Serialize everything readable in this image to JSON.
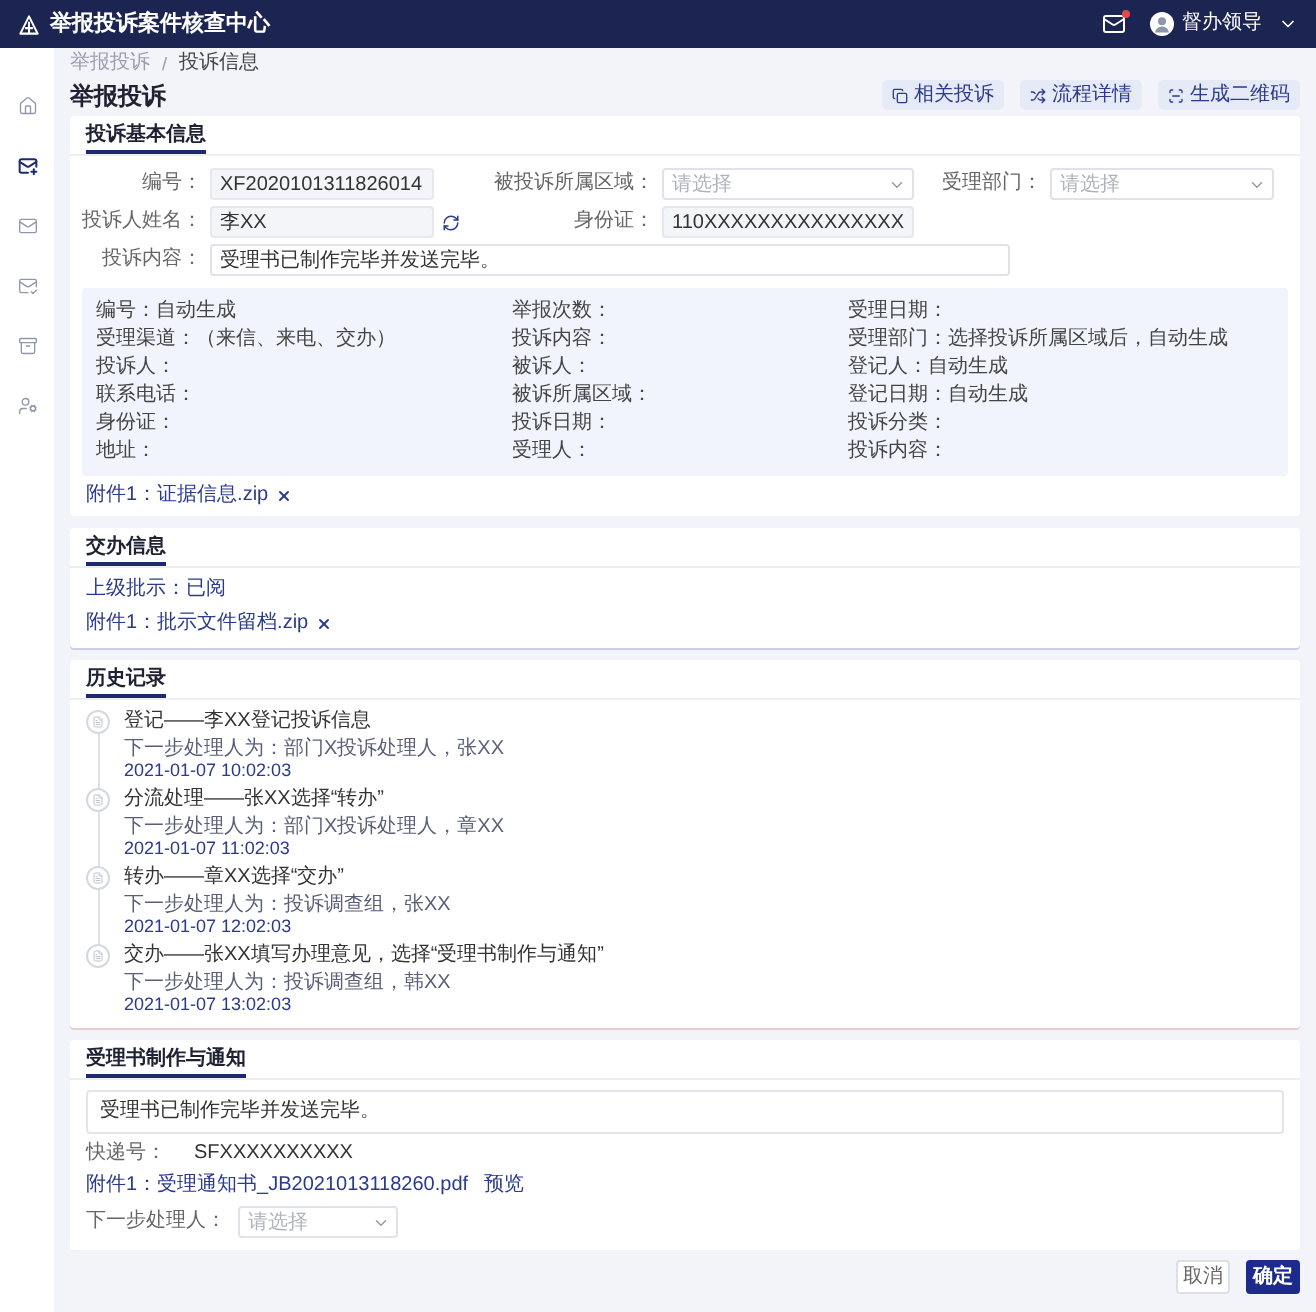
{
  "header": {
    "title": "举报投诉案件核查中心",
    "notification": true,
    "user": "督办领导"
  },
  "sidebar": {
    "items": [
      {
        "selected": false
      },
      {
        "selected": true
      },
      {
        "selected": false
      },
      {
        "selected": false
      },
      {
        "selected": false
      },
      {
        "selected": false
      }
    ]
  },
  "breadcrumb": {
    "items": [
      {
        "label": "举报投诉",
        "current": false
      },
      {
        "label": "投诉信息",
        "current": true
      }
    ],
    "separator": "/"
  },
  "page_title": "举报投诉",
  "actions": [
    {
      "label": "相关投诉"
    },
    {
      "label": "流程详情"
    },
    {
      "label": "生成二维码"
    }
  ],
  "basic_info": {
    "tabs": [
      {
        "label": "投诉基本信息",
        "selected": true
      }
    ],
    "form_rows": [
      [
        {
          "label": "编号：",
          "kind": "readonly",
          "value": "XF2020101311826014"
        },
        {
          "label": "被投诉所属区域：",
          "kind": "select",
          "placeholder": "请选择"
        },
        {
          "label": "受理部门：",
          "kind": "select",
          "placeholder": "请选择"
        }
      ],
      [
        {
          "label": "投诉人姓名：",
          "kind": "picker",
          "value": "李XX"
        },
        {
          "label": "身份证：",
          "kind": "readonly",
          "value": "110XXXXXXXXXXXXXXX"
        }
      ],
      [
        {
          "label": "投诉内容：",
          "kind": "text",
          "value": "受理书已制作完毕并发送完毕。"
        }
      ]
    ],
    "details": [
      {
        "label": "编号：",
        "value": "自动生成"
      },
      {
        "label": "举报次数："
      },
      {
        "label": "受理日期："
      },
      {
        "label": "受理渠道：",
        "value": "（来信、来电、交办）"
      },
      {
        "label": "投诉内容："
      },
      {
        "label": "受理部门：",
        "value": "选择投诉所属区域后，自动生成"
      },
      {
        "label": "投诉人："
      },
      {
        "label": "被诉人："
      },
      {
        "label": "登记人：",
        "value": "自动生成"
      },
      {
        "label": "联系电话："
      },
      {
        "label": "被诉所属区域："
      },
      {
        "label": "登记日期：",
        "value": "自动生成"
      },
      {
        "label": "身份证："
      },
      {
        "label": "投诉日期："
      },
      {
        "label": "投诉分类："
      },
      {
        "label": "地址："
      },
      {
        "label": "受理人："
      },
      {
        "label": "投诉内容："
      }
    ],
    "attachments": [
      {
        "name": "附件1：证据信息.zip"
      }
    ]
  },
  "handover": {
    "tabs": [
      {
        "label": "交办信息",
        "selected": true
      }
    ],
    "instruction": {
      "label": "上级批示：",
      "value": "已阅"
    },
    "attachments": [
      {
        "name": "附件1：批示文件留档.zip"
      }
    ]
  },
  "history": {
    "tabs": [
      {
        "label": "历史记录",
        "selected": true
      }
    ],
    "entries": [
      {
        "title": "登记——李XX登记投诉信息",
        "next": "下一步处理人为：部门X投诉处理人，张XX",
        "time": "2021-01-07 10:02:03"
      },
      {
        "title": "分流处理——张XX选择“转办”",
        "next": "下一步处理人为：部门X投诉处理人，章XX",
        "time": "2021-01-07 11:02:03"
      },
      {
        "title": "转办——章XX选择“交办”",
        "next": "下一步处理人为：投诉调查组，张XX",
        "time": "2021-01-07 12:02:03"
      },
      {
        "title": "交办——张XX填写办理意见，选择“受理书制作与通知”",
        "next": "下一步处理人为：投诉调查组，韩XX",
        "time": "2021-01-07 13:02:03"
      }
    ]
  },
  "notice": {
    "tabs": [
      {
        "label": "受理书制作与通知",
        "selected": true
      }
    ],
    "content": "受理书已制作完毕并发送完毕。",
    "tracking": {
      "label": "快递号：",
      "value": "SFXXXXXXXXXX"
    },
    "attachment": {
      "name": "附件1：受理通知书_JB2021013118260.pdf",
      "action": "预览"
    },
    "next_handler": {
      "label": "下一步处理人：",
      "placeholder": "请选择"
    }
  },
  "buttons": [
    {
      "label": "取消",
      "kind": "secondary"
    },
    {
      "label": "确定",
      "kind": "primary"
    }
  ]
}
